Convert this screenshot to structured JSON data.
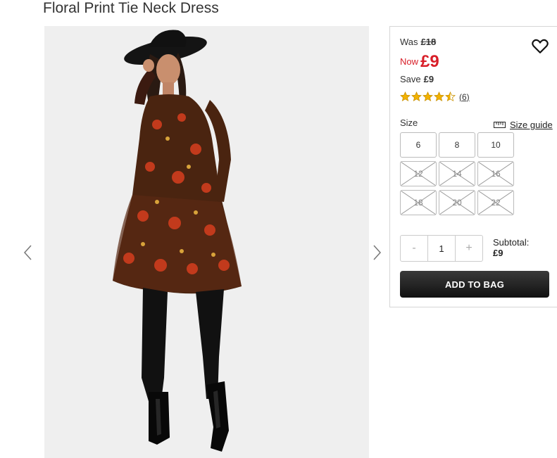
{
  "product": {
    "title": "Floral Print Tie Neck Dress"
  },
  "gallery": {
    "prev_icon": "chevron-left-icon",
    "next_icon": "chevron-right-icon"
  },
  "pricing": {
    "was_label": "Was",
    "was_price": "£18",
    "now_label": "Now",
    "now_price": "£9",
    "save_label": "Save",
    "save_amount": "£9",
    "sale_color": "#d81e28"
  },
  "wishlist": {
    "icon": "heart-icon"
  },
  "rating": {
    "stars": 4.5,
    "max": 5,
    "count": "(6)",
    "star_color": "#f2b200"
  },
  "size": {
    "label": "Size",
    "guide_label": "Size guide",
    "options": [
      {
        "label": "6",
        "available": true
      },
      {
        "label": "8",
        "available": true
      },
      {
        "label": "10",
        "available": true
      },
      {
        "label": "12",
        "available": false
      },
      {
        "label": "14",
        "available": false
      },
      {
        "label": "16",
        "available": false
      },
      {
        "label": "18",
        "available": false
      },
      {
        "label": "20",
        "available": false
      },
      {
        "label": "22",
        "available": false
      }
    ]
  },
  "quantity": {
    "minus": "-",
    "value": "1",
    "plus": "+"
  },
  "subtotal": {
    "label": "Subtotal:",
    "value": "£9"
  },
  "cta": {
    "add_to_bag": "ADD TO BAG"
  }
}
